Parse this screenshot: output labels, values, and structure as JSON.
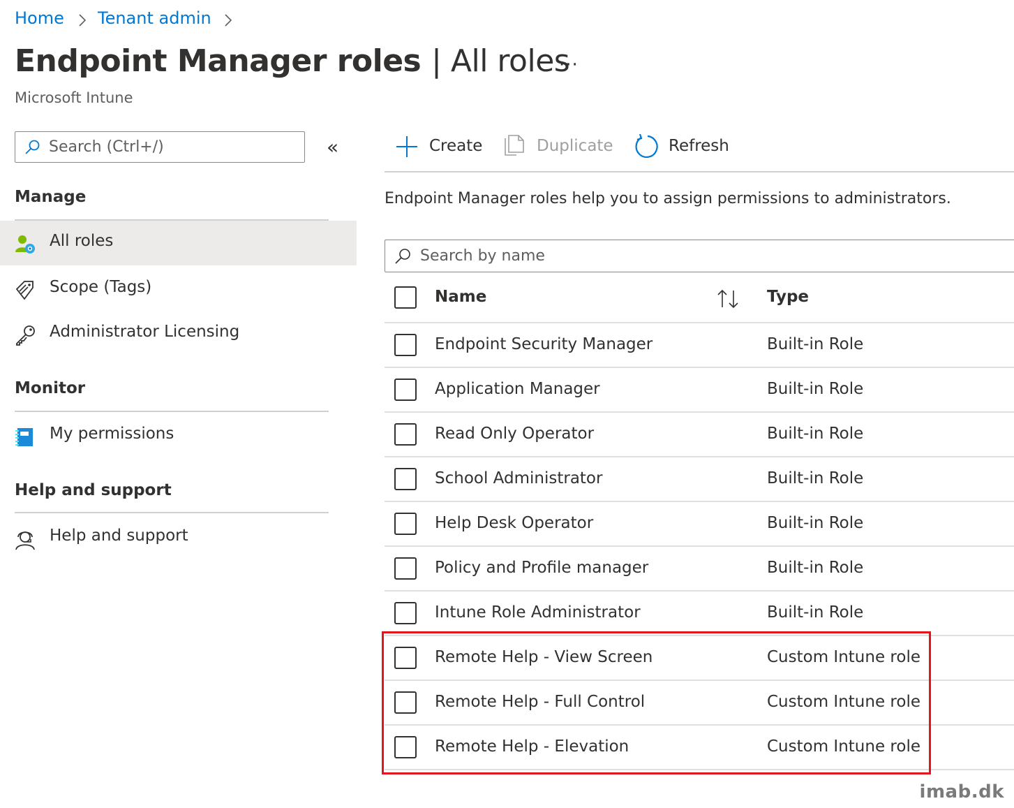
{
  "breadcrumb": [
    "Home",
    "Tenant admin"
  ],
  "page": {
    "title": "Endpoint Manager roles",
    "title_suffix": "| All roles",
    "subtitle": "Microsoft Intune",
    "more_label": "···"
  },
  "sidebar": {
    "search_placeholder": "Search (Ctrl+/)",
    "collapse_label": "«",
    "sections": [
      {
        "heading": "Manage",
        "items": [
          {
            "label": "All roles",
            "icon": "users-role-icon",
            "active": true
          },
          {
            "label": "Scope (Tags)",
            "icon": "tags-icon"
          },
          {
            "label": "Administrator Licensing",
            "icon": "key-icon"
          }
        ]
      },
      {
        "heading": "Monitor",
        "items": [
          {
            "label": "My permissions",
            "icon": "notebook-icon"
          }
        ]
      },
      {
        "heading": "Help and support",
        "items": [
          {
            "label": "Help and support",
            "icon": "support-agent-icon"
          }
        ]
      }
    ]
  },
  "toolbar": {
    "create_label": "Create",
    "duplicate_label": "Duplicate",
    "refresh_label": "Refresh"
  },
  "description": "Endpoint Manager roles help you to assign permissions to administrators.",
  "grid": {
    "search_placeholder": "Search by name",
    "columns": {
      "name": "Name",
      "type": "Type"
    },
    "rows": [
      {
        "name": "Endpoint Security Manager",
        "type": "Built-in Role"
      },
      {
        "name": "Application Manager",
        "type": "Built-in Role"
      },
      {
        "name": "Read Only Operator",
        "type": "Built-in Role"
      },
      {
        "name": "School Administrator",
        "type": "Built-in Role"
      },
      {
        "name": "Help Desk Operator",
        "type": "Built-in Role"
      },
      {
        "name": "Policy and Profile manager",
        "type": "Built-in Role"
      },
      {
        "name": "Intune Role Administrator",
        "type": "Built-in Role"
      },
      {
        "name": "Remote Help - View Screen",
        "type": "Custom Intune role"
      },
      {
        "name": "Remote Help - Full Control",
        "type": "Custom Intune role"
      },
      {
        "name": "Remote Help - Elevation",
        "type": "Custom Intune role"
      }
    ]
  },
  "colors": {
    "accent": "#0078d4",
    "highlight_border": "#e3151c"
  },
  "watermark": "imab.dk"
}
